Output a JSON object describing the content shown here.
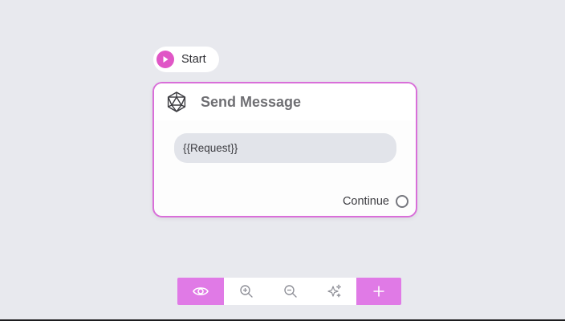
{
  "canvas": {
    "background": "#e8e9ee"
  },
  "start_node": {
    "label": "Start",
    "icon": "play-icon",
    "accent": "#e056c6"
  },
  "message_node": {
    "title": "Send Message",
    "icon": "icosahedron-icon",
    "message_value": "{{Request}}",
    "output_label": "Continue",
    "border_color": "#d96fd9"
  },
  "toolbar": {
    "accent": "#e07ae6",
    "buttons": [
      {
        "name": "preview",
        "icon": "eye-icon"
      },
      {
        "name": "zoom-in",
        "icon": "zoom-in-icon"
      },
      {
        "name": "zoom-out",
        "icon": "zoom-out-icon"
      },
      {
        "name": "auto-layout",
        "icon": "sparkles-icon"
      },
      {
        "name": "add-node",
        "icon": "plus-icon"
      }
    ]
  }
}
